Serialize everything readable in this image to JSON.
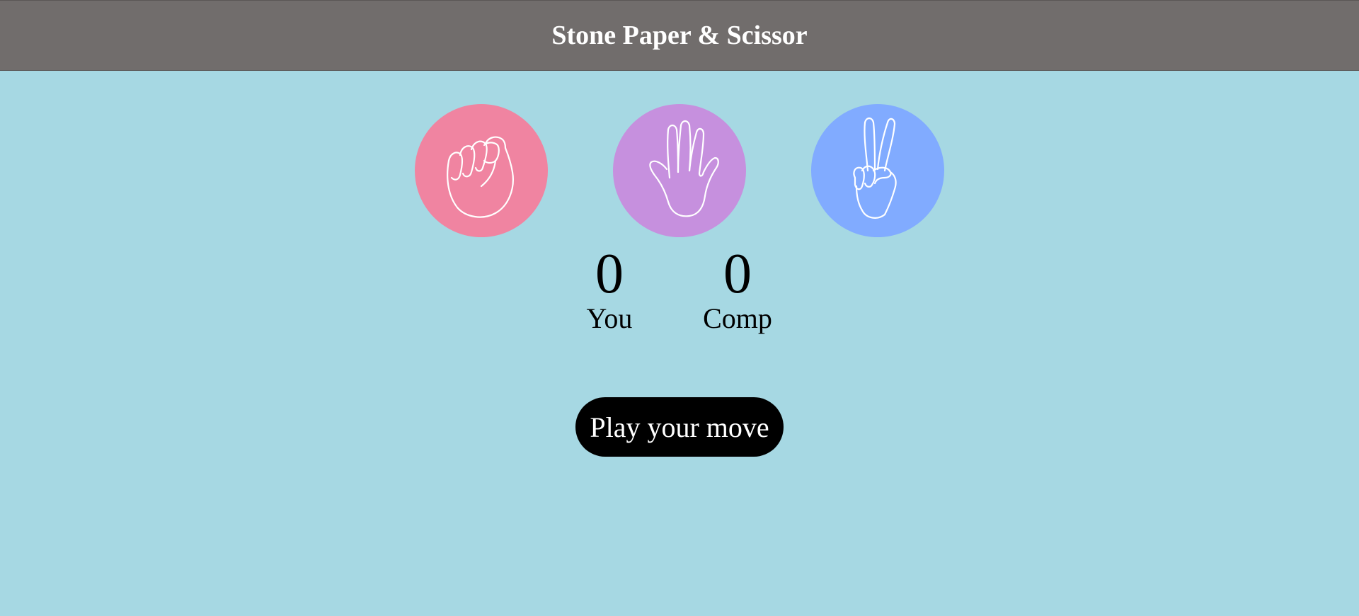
{
  "header": {
    "title": "Stone Paper & Scissor"
  },
  "choices": [
    {
      "name": "stone",
      "icon": "fist-icon",
      "color": "#f084a1"
    },
    {
      "name": "paper",
      "icon": "open-hand-icon",
      "color": "#c690de"
    },
    {
      "name": "scissor",
      "icon": "victory-hand-icon",
      "color": "#81abff"
    }
  ],
  "scoreboard": {
    "user": {
      "score": "0",
      "label": "You"
    },
    "comp": {
      "score": "0",
      "label": "Comp"
    }
  },
  "message": {
    "text": "Play your move",
    "background": "#000000",
    "color": "#ffffff"
  },
  "colors": {
    "background": "#a6d8e3",
    "header": "#716d6c"
  }
}
